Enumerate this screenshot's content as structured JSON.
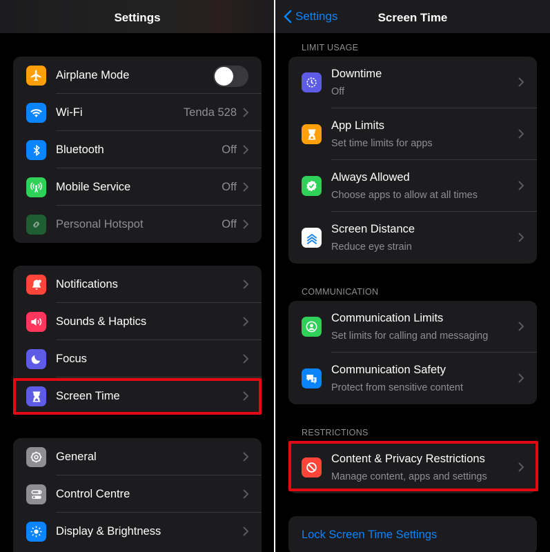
{
  "left": {
    "nav_title": "Settings",
    "group1": [
      {
        "icon": "airplane-icon",
        "color": "#ff9f0a",
        "label": "Airplane Mode",
        "control": "toggle",
        "toggle_on": false
      },
      {
        "icon": "wifi-icon",
        "color": "#0a84ff",
        "label": "Wi-Fi",
        "value": "Tenda 528"
      },
      {
        "icon": "bluetooth-icon",
        "color": "#0a84ff",
        "label": "Bluetooth",
        "value": "Off"
      },
      {
        "icon": "antenna-icon",
        "color": "#30d158",
        "label": "Mobile Service",
        "value": "Off"
      },
      {
        "icon": "hotspot-icon",
        "color": "#1f5e33",
        "label": "Personal Hotspot",
        "value": "Off",
        "dimmed": true
      }
    ],
    "group2": [
      {
        "icon": "bell-icon",
        "color": "#ff453a",
        "label": "Notifications"
      },
      {
        "icon": "speaker-icon",
        "color": "#ff375f",
        "label": "Sounds & Haptics"
      },
      {
        "icon": "moon-icon",
        "color": "#5e5ce6",
        "label": "Focus"
      },
      {
        "icon": "hourglass-icon",
        "color": "#5e5ce6",
        "label": "Screen Time",
        "highlighted": true
      }
    ],
    "group3": [
      {
        "icon": "gear-icon",
        "color": "#8e8e93",
        "label": "General"
      },
      {
        "icon": "switches-icon",
        "color": "#8e8e93",
        "label": "Control Centre"
      },
      {
        "icon": "sun-icon",
        "color": "#0a84ff",
        "label": "Display & Brightness"
      }
    ]
  },
  "right": {
    "back_label": "Settings",
    "nav_title": "Screen Time",
    "section_limit": "LIMIT USAGE",
    "limit_items": [
      {
        "icon": "downtime-icon",
        "color": "#5e5ce6",
        "title": "Downtime",
        "subtitle": "Off"
      },
      {
        "icon": "hourglass-icon",
        "color": "#ff9f0a",
        "title": "App Limits",
        "subtitle": "Set time limits for apps"
      },
      {
        "icon": "checkmark-shield-icon",
        "color": "#30d158",
        "title": "Always Allowed",
        "subtitle": "Choose apps to allow at all times"
      },
      {
        "icon": "screen-distance-icon",
        "color": "#ffffff",
        "title": "Screen Distance",
        "subtitle": "Reduce eye strain"
      }
    ],
    "section_communication": "COMMUNICATION",
    "communication_items": [
      {
        "icon": "person-circle-icon",
        "color": "#30d158",
        "title": "Communication Limits",
        "subtitle": "Set limits for calling and messaging"
      },
      {
        "icon": "chat-bubble-icon",
        "color": "#0a84ff",
        "title": "Communication Safety",
        "subtitle": "Protect from sensitive content"
      }
    ],
    "section_restrictions": "RESTRICTIONS",
    "restriction_items": [
      {
        "icon": "prohibited-icon",
        "color": "#ff453a",
        "title": "Content & Privacy Restrictions",
        "subtitle": "Manage content, apps and settings",
        "highlighted": true
      }
    ],
    "lock_label": "Lock Screen Time Settings"
  },
  "highlight_color": "#e50914"
}
